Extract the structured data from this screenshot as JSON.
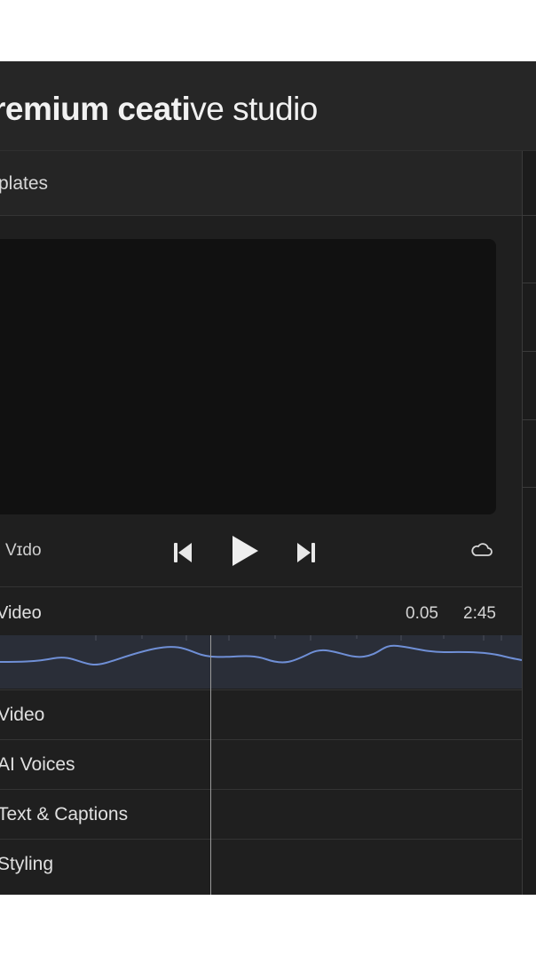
{
  "header": {
    "brand_bold": "remium ceati",
    "brand_light_mid": "ve",
    "brand_light": " studio"
  },
  "templates": {
    "label": "plates"
  },
  "player": {
    "label": "Vɪdo",
    "icons": [
      "skip-back-icon",
      "play-icon",
      "skip-forward-icon",
      "cloud-icon"
    ]
  },
  "timeline": {
    "title": "Video",
    "time_current": "0.05",
    "time_total": "2:45"
  },
  "tracks": [
    {
      "label": "Video"
    },
    {
      "label": "AI Voices"
    },
    {
      "label": "Text & Captions"
    },
    {
      "label": "Styling"
    }
  ],
  "colors": {
    "accent_wave": "#6f8fd6",
    "background": "#1f1f1f",
    "preview": "#111111"
  }
}
